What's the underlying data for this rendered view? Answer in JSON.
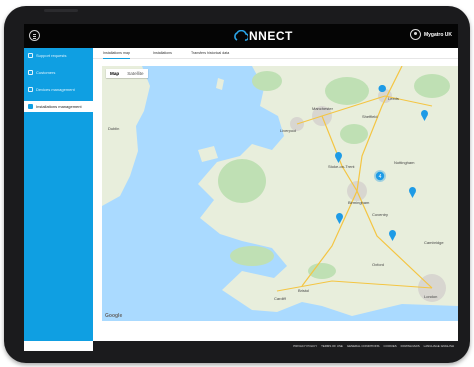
{
  "app": {
    "logo_text": "NNECT",
    "user_name": "Mygatro UK"
  },
  "sidebar": {
    "items": [
      {
        "label": "Support requests",
        "active": false
      },
      {
        "label": "Customers",
        "active": false
      },
      {
        "label": "Devices management",
        "active": false
      },
      {
        "label": "Installations management",
        "active": true
      }
    ]
  },
  "tabs": [
    {
      "label": "Installations map",
      "active": true
    },
    {
      "label": "Installations",
      "active": false
    },
    {
      "label": "Transfers historical data",
      "active": false
    }
  ],
  "map": {
    "type_buttons": [
      {
        "label": "Map",
        "selected": true
      },
      {
        "label": "Satellite",
        "selected": false
      }
    ],
    "attribution": "Google",
    "cluster_count": "4",
    "place_labels": [
      "Leeds",
      "Liverpool",
      "Manchester",
      "Sheffield",
      "Nottingham",
      "Birmingham",
      "Dublin",
      "Cardiff",
      "Bristol",
      "London",
      "Cambridge",
      "Oxford",
      "Stoke-on-Trent",
      "Coventry"
    ],
    "colors": {
      "sea": "#aadaff",
      "land": "#e8eedc",
      "park": "#bfe0b4",
      "marker": "#1e9be6"
    }
  },
  "footer": {
    "links": [
      "PRIVACY POLICY",
      "TERMS OF USE",
      "GENERAL CONDITIONS",
      "COOKIES",
      "DOWNLOADS",
      "LANGUAGE: ENGLISH"
    ]
  }
}
